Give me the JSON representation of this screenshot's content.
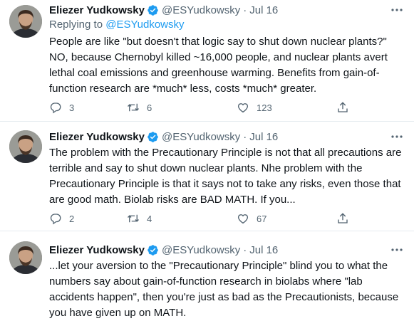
{
  "tweets": [
    {
      "name": "Eliezer Yudkowsky",
      "handle": "@ESYudkowsky",
      "time": "Jul 16",
      "replying_prefix": "Replying to ",
      "replying_to": "@ESYudkowsky",
      "text": "People are like \"but doesn't that logic say to shut down nuclear plants?\"\nNO, because Chernobyl killed ~16,000 people, and nuclear plants avert\nlethal coal emissions and greenhouse warming.  Benefits from gain-of-\nfunction research are *much* less, costs *much* greater.",
      "replies": "3",
      "retweets": "6",
      "likes": "123"
    },
    {
      "name": "Eliezer Yudkowsky",
      "handle": "@ESYudkowsky",
      "time": "Jul 16",
      "text": "The problem with the Precautionary Principle is not that all precautions are\nterrible and say to shut down nuclear plants.  Nhe problem with the\nPrecautionary Principle is that it says not to take any risks, even those that\nare good math.  Biolab risks are BAD MATH.  If you...",
      "replies": "2",
      "retweets": "4",
      "likes": "67"
    },
    {
      "name": "Eliezer Yudkowsky",
      "handle": "@ESYudkowsky",
      "time": "Jul 16",
      "text": "...let your aversion to the \"Precautionary Principle\" blind you to what the\nnumbers say about gain-of-function research in biolabs where \"lab\naccidents happen\", then you're just as bad as the Precautionists, because\nyou have given up on MATH."
    }
  ],
  "icons": {
    "verified": "verified-badge-icon",
    "more": "more-icon",
    "reply": "reply-icon",
    "retweet": "retweet-icon",
    "like": "like-icon",
    "share": "share-icon"
  },
  "colors": {
    "text": "#0f1419",
    "secondary": "#536471",
    "link": "#1d9bf0",
    "verified": "#1d9bf0",
    "divider": "#e6ecf0"
  },
  "separator": "·"
}
